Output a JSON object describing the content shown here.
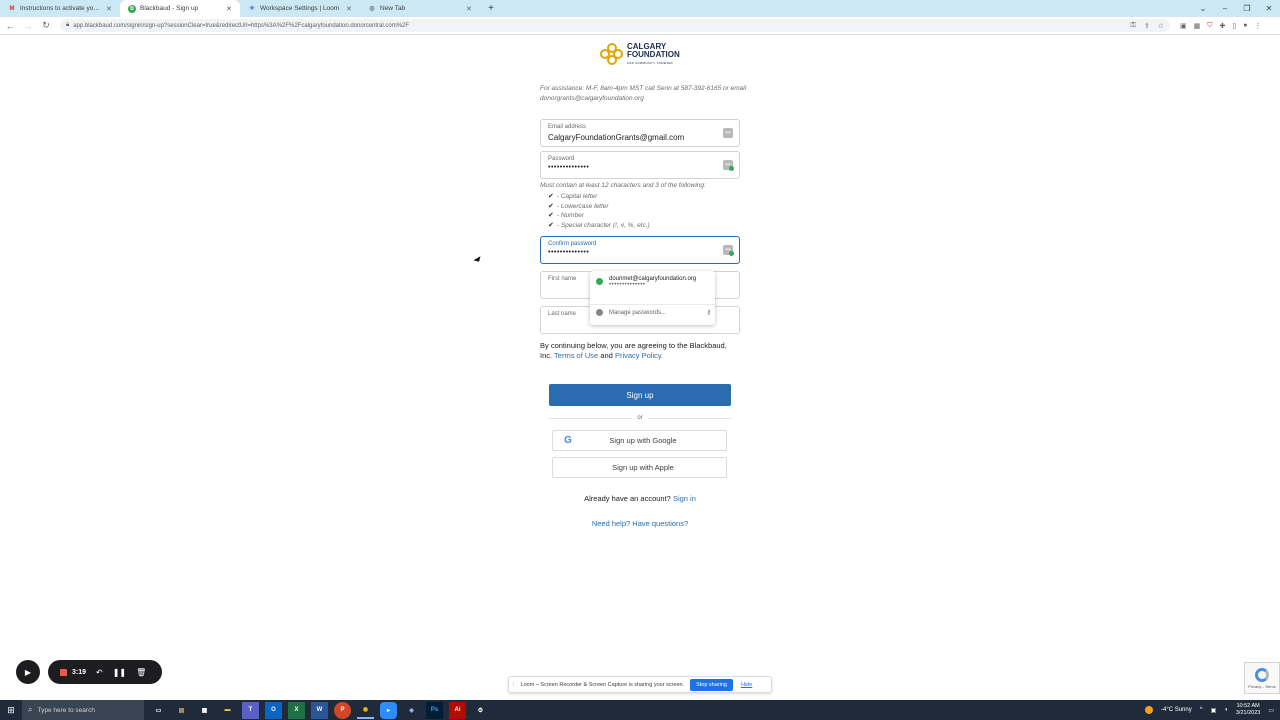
{
  "browser": {
    "tabs": [
      {
        "label": "Instructions to activate your Do",
        "icon": "gmail-icon",
        "color": "#d93025",
        "glyph": "M"
      },
      {
        "label": "Blackbaud - Sign up",
        "icon": "blackbaud-icon",
        "color": "#36a853",
        "glyph": "b"
      },
      {
        "label": "Workspace Settings | Loom",
        "icon": "loom-icon",
        "color": "#625df5",
        "glyph": "✳"
      },
      {
        "label": "New Tab",
        "icon": "chrome-icon",
        "color": "#5f6368",
        "glyph": "◎"
      }
    ],
    "new_tab": "+",
    "url": "app.blackbaud.com/signin/sign-up?sessionClear=true&redirectUrl=https%3A%2F%2Fcalgaryfoundation.donorcentral.com%2F"
  },
  "logo": {
    "line1": "CALGARY",
    "line2": "FOUNDATION",
    "tagline": "FOR COMMUNITY. FOREVER"
  },
  "assistance": "For assistance: M-F, 8am-4pm MST call Serin at 587-392-6165 or email donorgrants@calgaryfoundation.org",
  "form": {
    "email": {
      "label": "Email address",
      "value": "CalgaryFoundationGrants@gmail.com"
    },
    "password": {
      "label": "Password",
      "value": "••••••••••••••"
    },
    "requirements_title": "Must contain at least 12 characters and 3 of the following:",
    "requirements": [
      "- Capital letter",
      "- Lowercase letter",
      "- Number",
      "- Special character (!, #, %, etc.)"
    ],
    "confirm": {
      "label": "Confirm password",
      "value": "••••••••••••••"
    },
    "first_name": {
      "label": "First name",
      "value": ""
    },
    "last_name": {
      "label": "Last name",
      "value": ""
    }
  },
  "autofill": {
    "email": "dourimet@calgaryfoundation.org",
    "password": "••••••••••••••",
    "manage": "Manage passwords..."
  },
  "terms": {
    "prefix": "By continuing below, you are agreeing to the Blackbaud, Inc.",
    "terms_link": "Terms of Use",
    "and": "and",
    "privacy_link": "Privacy Policy."
  },
  "buttons": {
    "signup": "Sign up",
    "or": "or",
    "google": "Sign up with Google",
    "apple": "Sign up with Apple"
  },
  "signin": {
    "text": "Already have an account?",
    "link": "Sign in"
  },
  "help": "Need help? Have questions?",
  "loom": {
    "time": "3:19",
    "share_text": "Loom – Screen Recorder & Screen Capture is sharing your screen.",
    "stop_sharing": "Stop sharing",
    "hide": "Hide"
  },
  "recaptcha": "Privacy - Terms",
  "taskbar": {
    "search_placeholder": "Type here to search",
    "weather": "-4°C  Sunny",
    "time": "10:52 AM",
    "date": "3/21/2023"
  },
  "colors": {
    "primary": "#2b6cb0",
    "tabbar": "#cde8f5",
    "taskbar": "#1f2b3a"
  }
}
